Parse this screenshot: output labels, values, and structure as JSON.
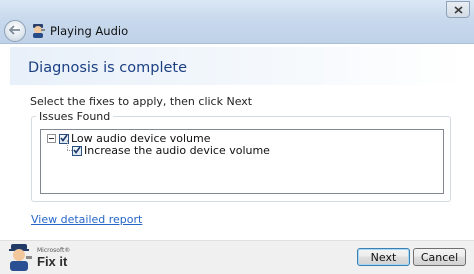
{
  "window": {
    "title": "Playing Audio"
  },
  "header": {
    "title": "Diagnosis is complete"
  },
  "instructions": "Select the fixes to apply, then click Next",
  "issues": {
    "legend": "Issues Found",
    "items": [
      {
        "label": "Low audio device volume",
        "checked": true,
        "expanded": true
      },
      {
        "label": "Increase the audio device volume",
        "checked": true
      }
    ]
  },
  "links": {
    "detailed_report": "View detailed report"
  },
  "footer": {
    "brand_small": "Microsoft®",
    "brand_big": "Fix it",
    "next_label": "Next",
    "cancel_label": "Cancel"
  },
  "icons": {
    "close": "close-icon",
    "back": "back-arrow-icon",
    "app": "fixit-mascot-icon",
    "check": "check-icon",
    "expander": "collapse-icon"
  },
  "colors": {
    "header_title": "#1c3f82",
    "link": "#2766c8"
  }
}
